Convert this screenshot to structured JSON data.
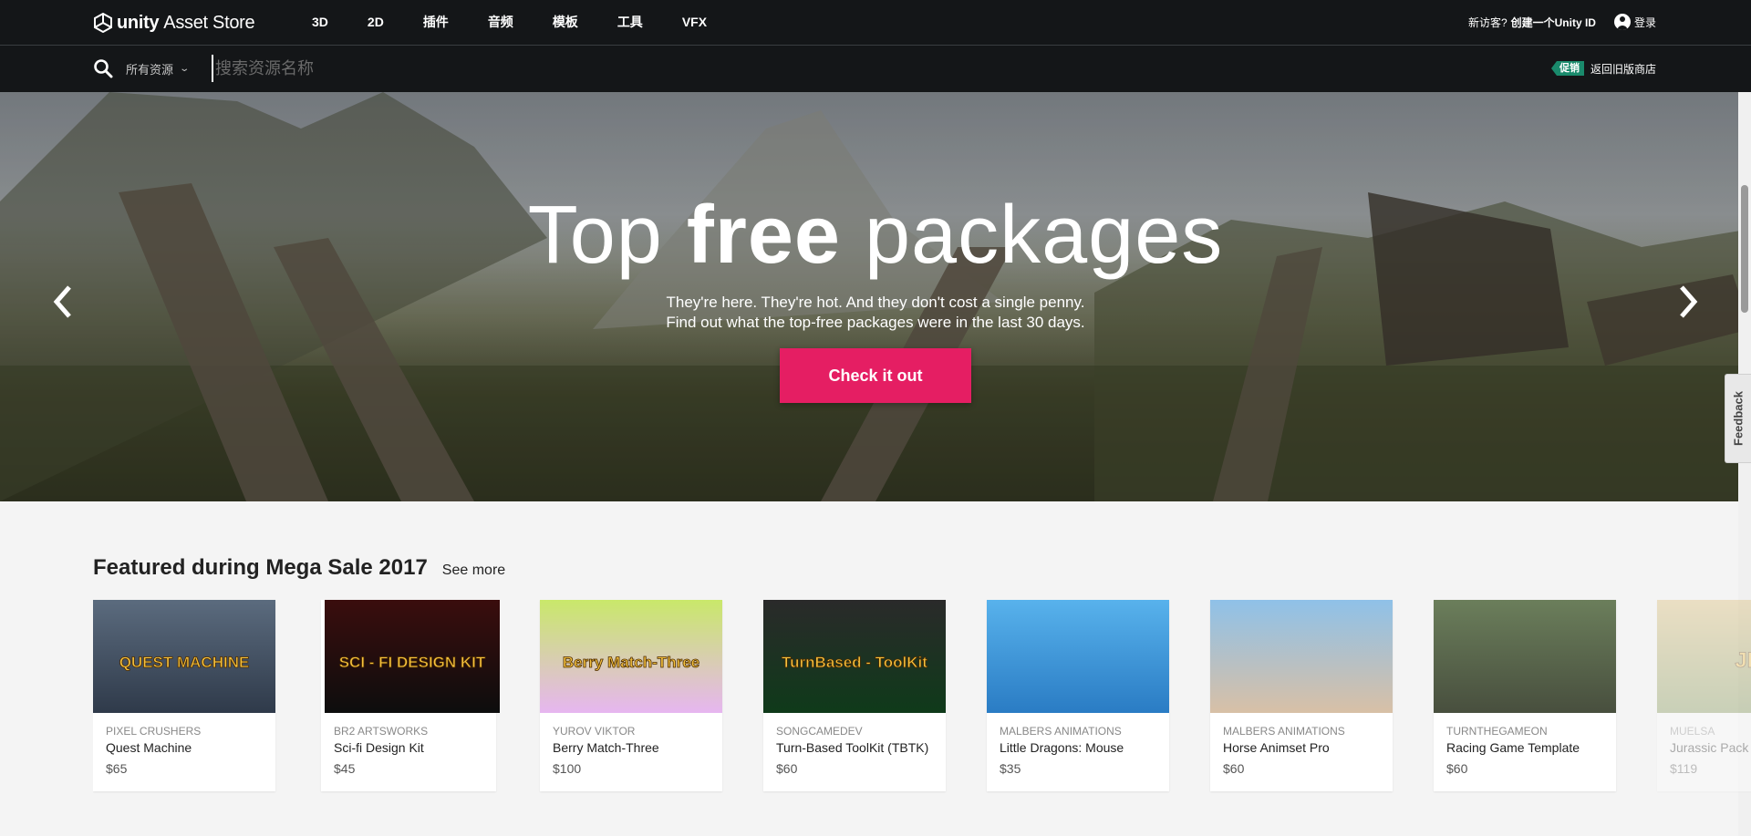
{
  "brand": {
    "unity": "unity",
    "store": "Asset Store"
  },
  "nav": [
    "3D",
    "2D",
    "插件",
    "音频",
    "模板",
    "工具",
    "VFX"
  ],
  "account": {
    "new_visitor": "新访客?",
    "create_id": "创建一个Unity ID",
    "login": "登录"
  },
  "search": {
    "scope": "所有资源",
    "placeholder": "搜索资源名称",
    "promo": "促销",
    "old_store": "返回旧版商店"
  },
  "hero": {
    "title_pre": "Top ",
    "title_bold": "free",
    "title_post": " packages",
    "line1": "They're here. They're hot. And they don't cost a single penny.",
    "line2": "Find out what the top-free packages were in the last 30 days.",
    "cta": "Check it out"
  },
  "feedback": "Feedback",
  "featured": {
    "title": "Featured during Mega Sale 2017",
    "see_more": "See more",
    "items": [
      {
        "publisher": "PIXEL CRUSHERS",
        "name": "Quest Machine",
        "price": "$65",
        "thumb_text": "QUEST MACHINE",
        "colors": [
          "#5b6b7e",
          "#2f3a4a"
        ]
      },
      {
        "publisher": "BR2 ARTSWORKS",
        "name": "Sci-fi Design Kit",
        "price": "$45",
        "thumb_text": "SCI - FI DESIGN KIT",
        "colors": [
          "#3a0d0d",
          "#0d0d0d"
        ]
      },
      {
        "publisher": "YUROV VIKTOR",
        "name": "Berry Match-Three",
        "price": "$100",
        "thumb_text": "Berry Match-Three",
        "colors": [
          "#c9e86a",
          "#e6b6f0"
        ]
      },
      {
        "publisher": "SONGCAMEDEV",
        "name": "Turn-Based ToolKit (TBTK)",
        "price": "$60",
        "thumb_text": "TurnBased - ToolKit",
        "colors": [
          "#2a2a2a",
          "#0f3a1a"
        ]
      },
      {
        "publisher": "MALBERS ANIMATIONS",
        "name": "Little Dragons: Mouse",
        "price": "$35",
        "thumb_text": "",
        "colors": [
          "#58b2ec",
          "#2a7cc4"
        ]
      },
      {
        "publisher": "MALBERS ANIMATIONS",
        "name": "Horse Animset Pro",
        "price": "$60",
        "thumb_text": "",
        "colors": [
          "#8fc1e8",
          "#d8c0a6"
        ]
      },
      {
        "publisher": "TURNTHEGAMEON",
        "name": "Racing Game Template",
        "price": "$60",
        "thumb_text": "",
        "colors": [
          "#6b7e5b",
          "#484f3e"
        ]
      },
      {
        "publisher": "MUELSA",
        "name": "Jurassic Pack",
        "price": "$119",
        "thumb_text": "JP",
        "colors": [
          "#d9b86a",
          "#7a8f4a"
        ]
      }
    ]
  }
}
